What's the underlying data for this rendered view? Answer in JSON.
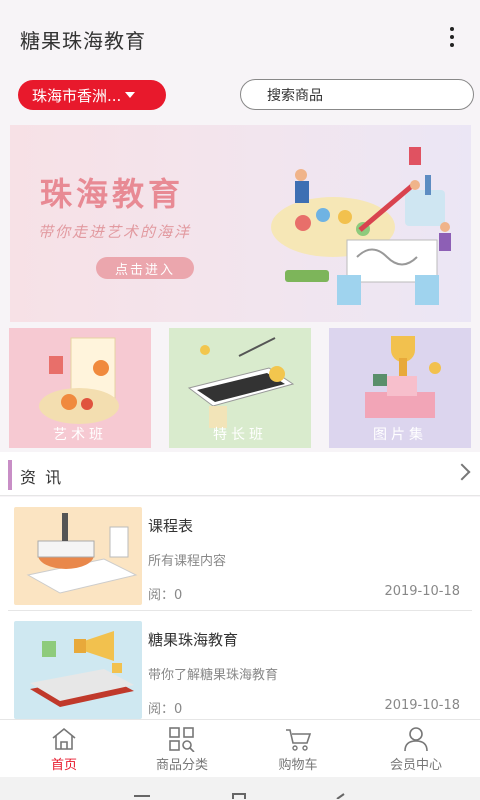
{
  "app": {
    "title": "糖果珠海教育"
  },
  "location": {
    "label": "珠海市香洲..."
  },
  "search": {
    "placeholder": "搜索商品"
  },
  "banner": {
    "title": "珠海教育",
    "subtitle": "带你走进艺术的海洋",
    "button": "点击进入"
  },
  "tiles": [
    {
      "label": "艺术班"
    },
    {
      "label": "特长班"
    },
    {
      "label": "图片集"
    }
  ],
  "news": {
    "header": "资 讯",
    "items": [
      {
        "title": "课程表",
        "desc": "所有课程内容",
        "reads": "阅：0",
        "date": "2019-10-18"
      },
      {
        "title": "糖果珠海教育",
        "desc": "带你了解糖果珠海教育",
        "reads": "阅：0",
        "date": "2019-10-18"
      }
    ]
  },
  "tabbar": {
    "items": [
      {
        "label": "首页",
        "icon": "home-icon",
        "active": true
      },
      {
        "label": "商品分类",
        "icon": "grid-search-icon"
      },
      {
        "label": "购物车",
        "icon": "cart-icon"
      },
      {
        "label": "会员中心",
        "icon": "user-icon"
      }
    ]
  },
  "colors": {
    "accent": "#e8192c",
    "section_bar": "#c88ec6"
  }
}
